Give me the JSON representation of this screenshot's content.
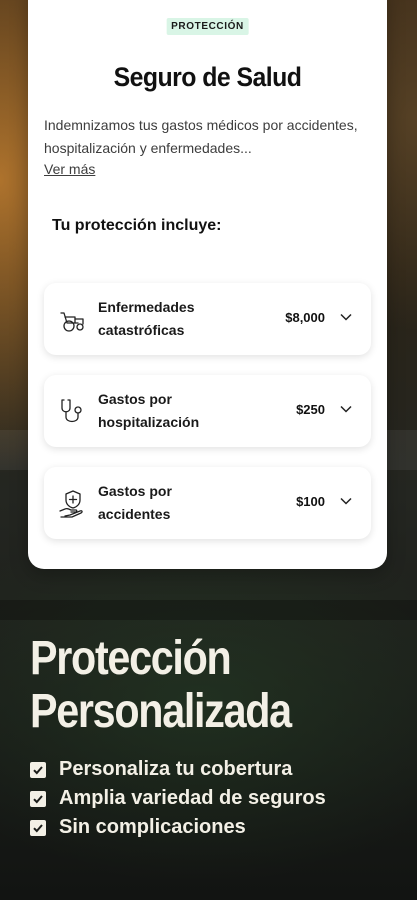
{
  "card": {
    "badge": "PROTECCIÓN",
    "title": "Seguro de Salud",
    "description": "Indemnizamos tus gastos médicos por accidentes, hospitalización y enfermedades...",
    "see_more": "Ver más",
    "includes_title": "Tu protección incluye:",
    "items": [
      {
        "label": "Enfermedades catastróficas",
        "price": "$8,000",
        "icon": "wheelchair-icon"
      },
      {
        "label": "Gastos por hospitalización",
        "price": "$250",
        "icon": "stethoscope-icon"
      },
      {
        "label": "Gastos por accidentes",
        "price": "$100",
        "icon": "shield-hand-icon"
      }
    ]
  },
  "promo": {
    "title_line1": "Protección",
    "title_line2": "Personalizada",
    "features": [
      "Personaliza tu cobertura",
      "Amplia variedad de seguros",
      "Sin complicaciones"
    ]
  },
  "colors": {
    "accent_purple": "#7a3fe0",
    "badge_bg": "#d9f5e6",
    "promo_text": "#f3f0e6"
  }
}
